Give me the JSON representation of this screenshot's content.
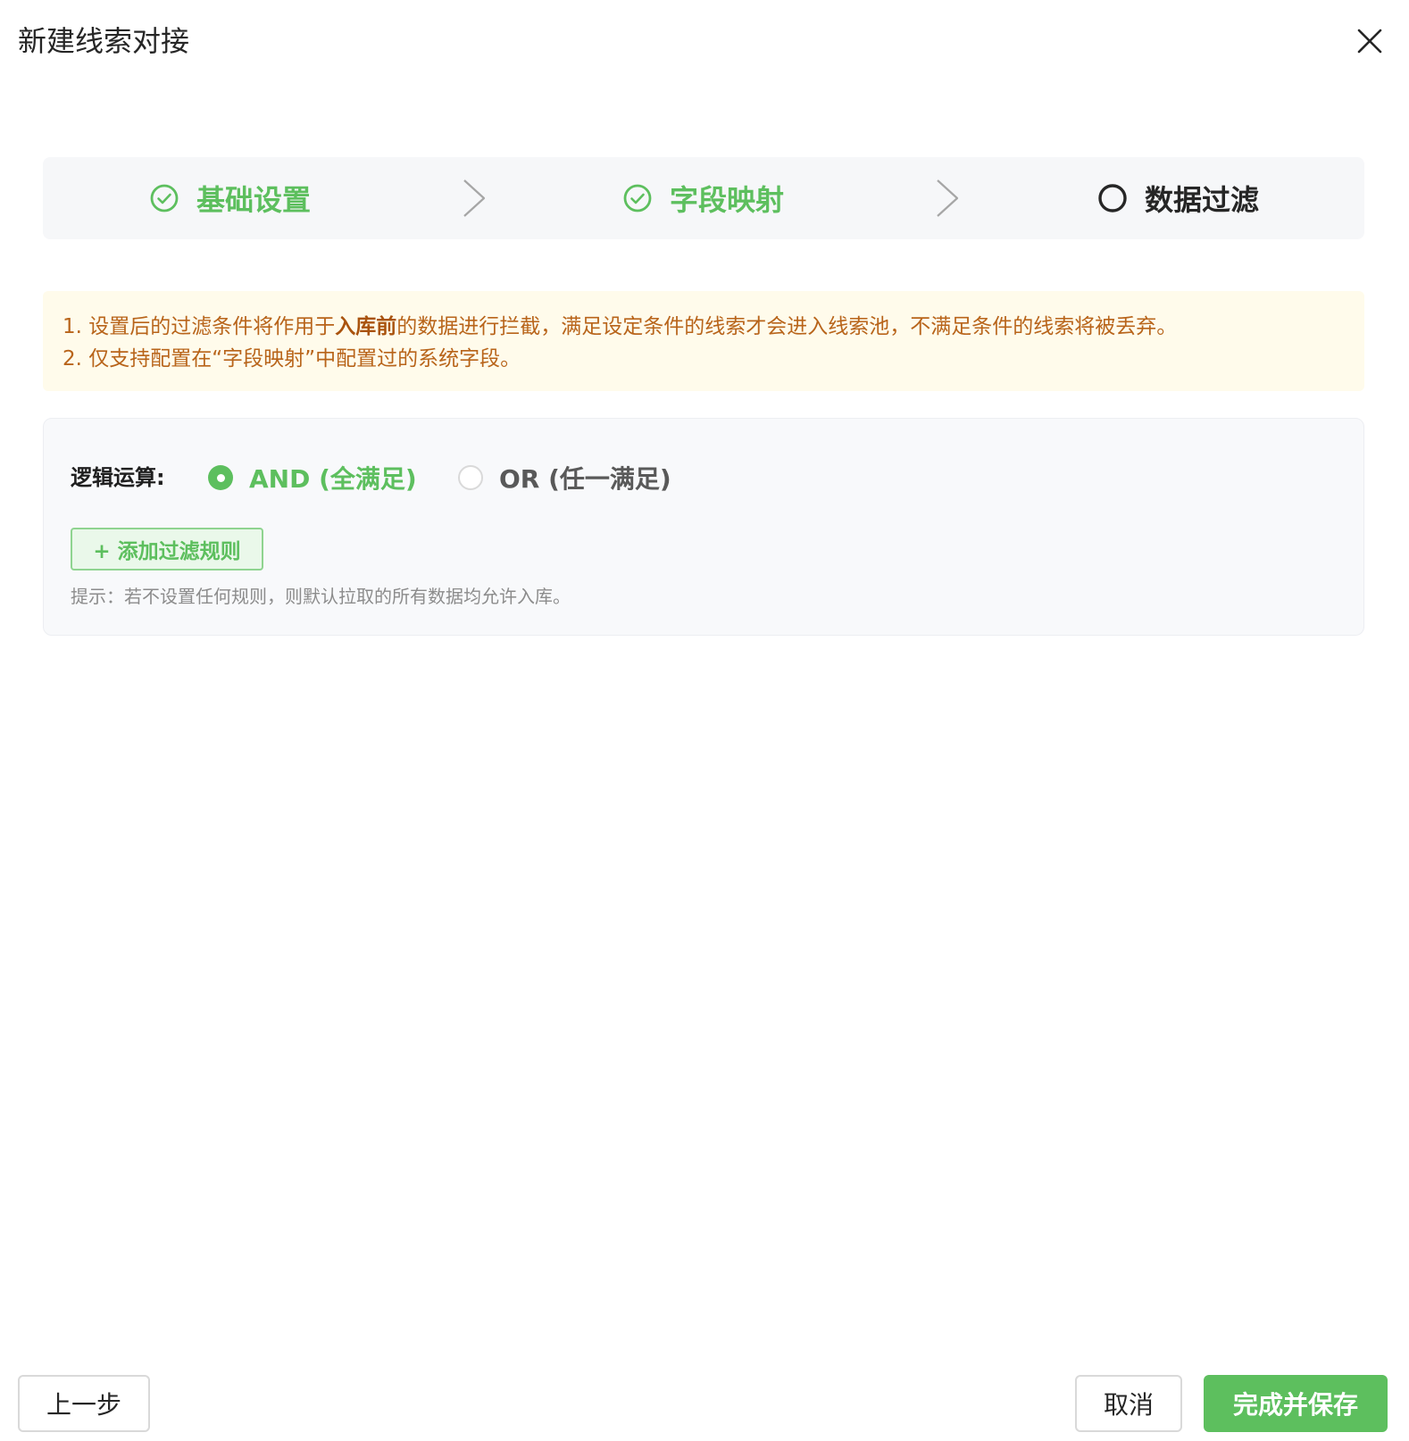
{
  "modal": {
    "title": "新建线索对接"
  },
  "steps": [
    {
      "label": "基础设置",
      "status": "done"
    },
    {
      "label": "字段映射",
      "status": "done"
    },
    {
      "label": "数据过滤",
      "status": "current"
    }
  ],
  "notice": {
    "line1_prefix": "1. 设置后的过滤条件将作用于",
    "line1_emphasis": "入库前",
    "line1_suffix": "的数据进行拦截，满足设定条件的线索才会进入线索池，不满足条件的线索将被丢弃。",
    "line2": "2. 仅支持配置在“字段映射”中配置过的系统字段。"
  },
  "filter": {
    "logic_label": "逻辑运算:",
    "options": [
      {
        "label": "AND (全满足)",
        "selected": true
      },
      {
        "label": "OR (任一满足)",
        "selected": false
      }
    ],
    "add_rule_label": "+ 添加过滤规则",
    "hint": "提示：若不设置任何规则，则默认拉取的所有数据均允许入库。"
  },
  "footer": {
    "prev_label": "上一步",
    "cancel_label": "取消",
    "save_label": "完成并保存"
  },
  "colors": {
    "accent": "#5dbf5e",
    "notice_bg": "#fffbeb",
    "notice_text": "#b8641a",
    "panel_bg": "#f8f9fb"
  },
  "icons": {
    "close": "close-icon",
    "step_done": "check-circle-icon",
    "step_current": "circle-icon",
    "step_separator": "chevron-right-icon"
  }
}
